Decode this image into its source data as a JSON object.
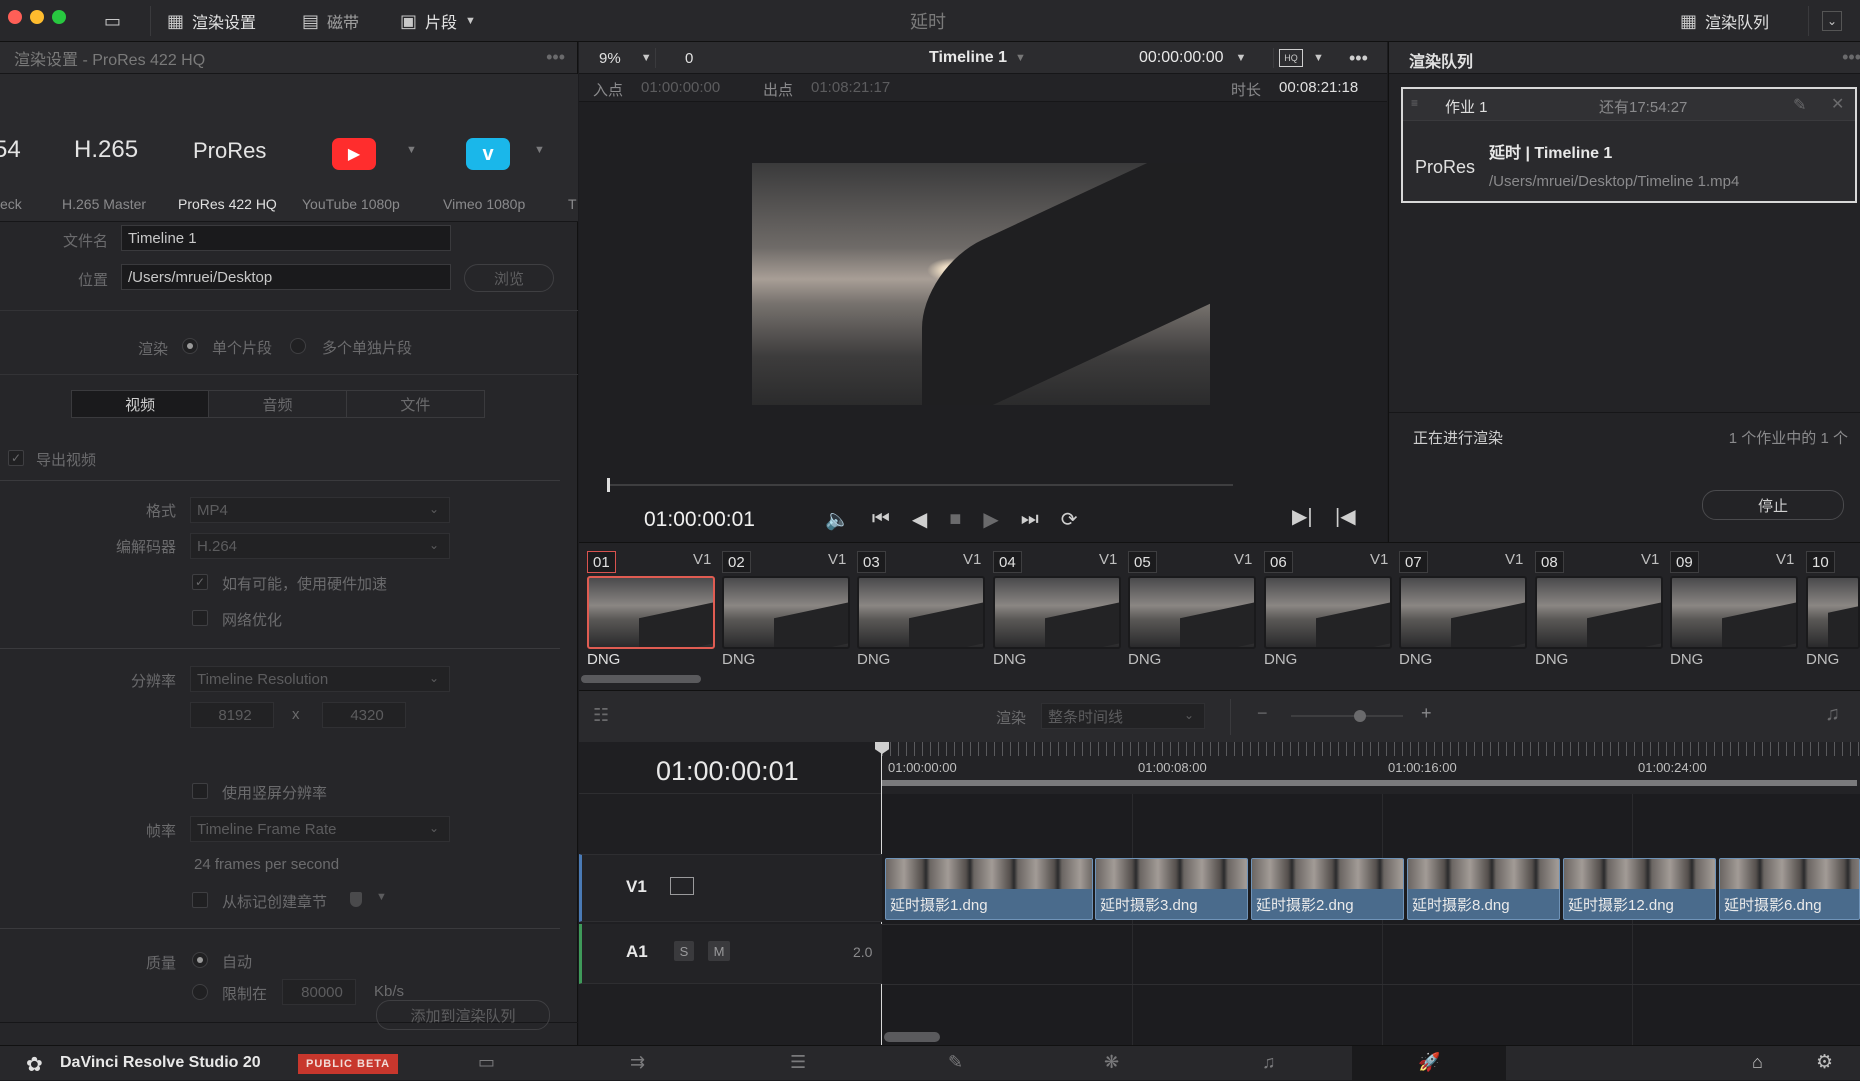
{
  "window": {
    "title": "延时"
  },
  "topbar": {
    "render_settings_label": "渲染设置",
    "tape_label": "磁带",
    "clips_label": "片段",
    "render_queue_label": "渲染队列"
  },
  "render_settings": {
    "header": "渲染设置 - ProRes 422 HQ",
    "presets": [
      {
        "title": "54",
        "sub": "eck"
      },
      {
        "title": "H.265",
        "sub": "H.265 Master"
      },
      {
        "title": "ProRes",
        "sub": "ProRes 422 HQ"
      },
      {
        "title": "",
        "sub": "YouTube 1080p"
      },
      {
        "title": "",
        "sub": "Vimeo 1080p"
      },
      {
        "title": "",
        "sub": "T"
      }
    ],
    "filename_label": "文件名",
    "filename_value": "Timeline 1",
    "location_label": "位置",
    "location_value": "/Users/mruei/Desktop",
    "browse_label": "浏览",
    "render_label": "渲染",
    "single_clip_label": "单个片段",
    "multi_clip_label": "多个单独片段",
    "tabs": [
      "视频",
      "音频",
      "文件"
    ],
    "export_video_label": "导出视频",
    "format_label": "格式",
    "format_value": "MP4",
    "codec_label": "编解码器",
    "codec_value": "H.264",
    "hw_accel_label": "如有可能，使用硬件加速",
    "network_opt_label": "网络优化",
    "resolution_label": "分辨率",
    "resolution_value": "Timeline Resolution",
    "res_width": "8192",
    "res_x": "x",
    "res_height": "4320",
    "vertical_res_label": "使用竖屏分辨率",
    "framerate_label": "帧率",
    "framerate_value": "Timeline Frame Rate",
    "fps_text": "24 frames per second",
    "chapters_label": "从标记创建章节",
    "quality_label": "质量",
    "auto_label": "自动",
    "limit_label": "限制在",
    "limit_value": "80000",
    "limit_unit": "Kb/s",
    "add_queue_label": "添加到渲染队列"
  },
  "viewer": {
    "zoom": "9%",
    "counter": "0",
    "timeline_name": "Timeline 1",
    "timecode": "00:00:00:00",
    "in_label": "入点",
    "in_value": "01:00:00:00",
    "out_label": "出点",
    "out_value": "01:08:21:17",
    "duration_label": "时长",
    "duration_value": "00:08:21:18",
    "current_tc": "01:00:00:01"
  },
  "queue": {
    "title": "渲染队列",
    "job_name": "作业 1",
    "job_remaining": "还有17:54:27",
    "job_format": "ProRes",
    "job_title": "延时 | Timeline 1",
    "job_path": "/Users/mruei/Desktop/Timeline 1.mp4",
    "rendering_label": "正在进行渲染",
    "rendering_count": "1 个作业中的 1 个",
    "stop_label": "停止"
  },
  "thumbs": [
    {
      "num": "01",
      "track": "V1",
      "codec": "DNG"
    },
    {
      "num": "02",
      "track": "V1",
      "codec": "DNG"
    },
    {
      "num": "03",
      "track": "V1",
      "codec": "DNG"
    },
    {
      "num": "04",
      "track": "V1",
      "codec": "DNG"
    },
    {
      "num": "05",
      "track": "V1",
      "codec": "DNG"
    },
    {
      "num": "06",
      "track": "V1",
      "codec": "DNG"
    },
    {
      "num": "07",
      "track": "V1",
      "codec": "DNG"
    },
    {
      "num": "08",
      "track": "V1",
      "codec": "DNG"
    },
    {
      "num": "09",
      "track": "V1",
      "codec": "DNG"
    },
    {
      "num": "10",
      "track": "",
      "codec": "DNG"
    }
  ],
  "timeline": {
    "render_label": "渲染",
    "render_value": "整条时间线",
    "current_tc": "01:00:00:01",
    "ruler": [
      "01:00:00:00",
      "01:00:08:00",
      "01:00:16:00",
      "01:00:24:00"
    ],
    "v1_label": "V1",
    "a1_label": "A1",
    "solo_label": "S",
    "mute_label": "M",
    "a1_level": "2.0",
    "clips": [
      "延时摄影1.dng",
      "延时摄影3.dng",
      "延时摄影2.dng",
      "延时摄影8.dng",
      "延时摄影12.dng",
      "延时摄影6.dng"
    ]
  },
  "bottombar": {
    "app_name": "DaVinci Resolve Studio 20",
    "badge": "PUBLIC BETA"
  }
}
